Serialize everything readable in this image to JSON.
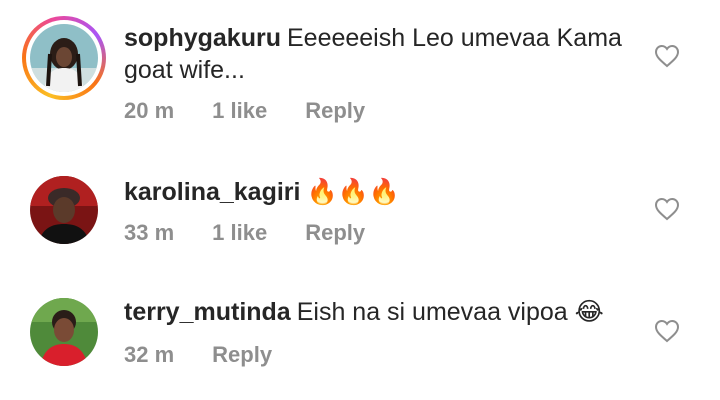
{
  "comments": [
    {
      "username": "sophygakuru",
      "text": "Eeeeeeish Leo umevaa Kama goat wife...",
      "time": "20 m",
      "likes": "1 like",
      "reply": "Reply",
      "has_story_ring": true
    },
    {
      "username": "karolina_kagiri",
      "text": "🔥🔥🔥",
      "time": "33 m",
      "likes": "1 like",
      "reply": "Reply",
      "has_story_ring": false
    },
    {
      "username": "terry_mutinda",
      "text": "Eish na si umevaa vipoa 😂",
      "time": "32 m",
      "likes": "",
      "reply": "Reply",
      "has_story_ring": false
    }
  ],
  "icons": {
    "like": "heart-outline-icon"
  },
  "colors": {
    "text": "#262626",
    "meta": "#8e8e8e"
  }
}
